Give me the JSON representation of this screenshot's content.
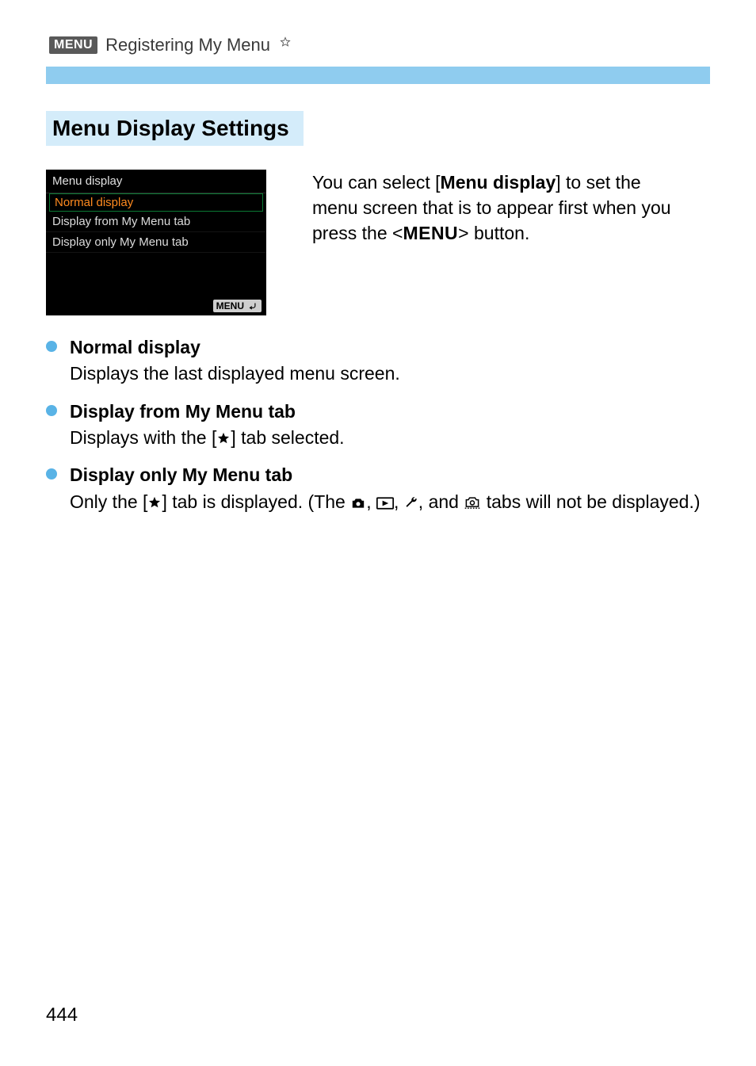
{
  "header": {
    "menu_badge": "MENU",
    "title": "Registering My Menu"
  },
  "section_heading": "Menu Display Settings",
  "lcd": {
    "title": "Menu display",
    "items": [
      {
        "label": "Normal display",
        "selected": true
      },
      {
        "label": "Display from My Menu tab",
        "selected": false
      },
      {
        "label": "Display only My Menu tab",
        "selected": false
      }
    ],
    "footer_chip": "MENU"
  },
  "description": {
    "pre": "You can select [",
    "bold": "Menu display",
    "mid": "] to set the menu screen that is to appear first when you press the <",
    "menu_word": "MENU",
    "post": "> button."
  },
  "bullets": [
    {
      "title": "Normal display",
      "text": "Displays the last displayed menu screen."
    },
    {
      "title": "Display from My Menu tab",
      "text_parts": {
        "pre": "Displays with the [",
        "post": "] tab selected."
      }
    },
    {
      "title": "Display only My Menu tab",
      "text_parts": {
        "pre": "Only the [",
        "mid1": "] tab is displayed. (The ",
        "mid2": ", ",
        "mid3": ", ",
        "mid4": ", and ",
        "post": " tabs will not be displayed.)"
      }
    }
  ],
  "page_number": "444"
}
